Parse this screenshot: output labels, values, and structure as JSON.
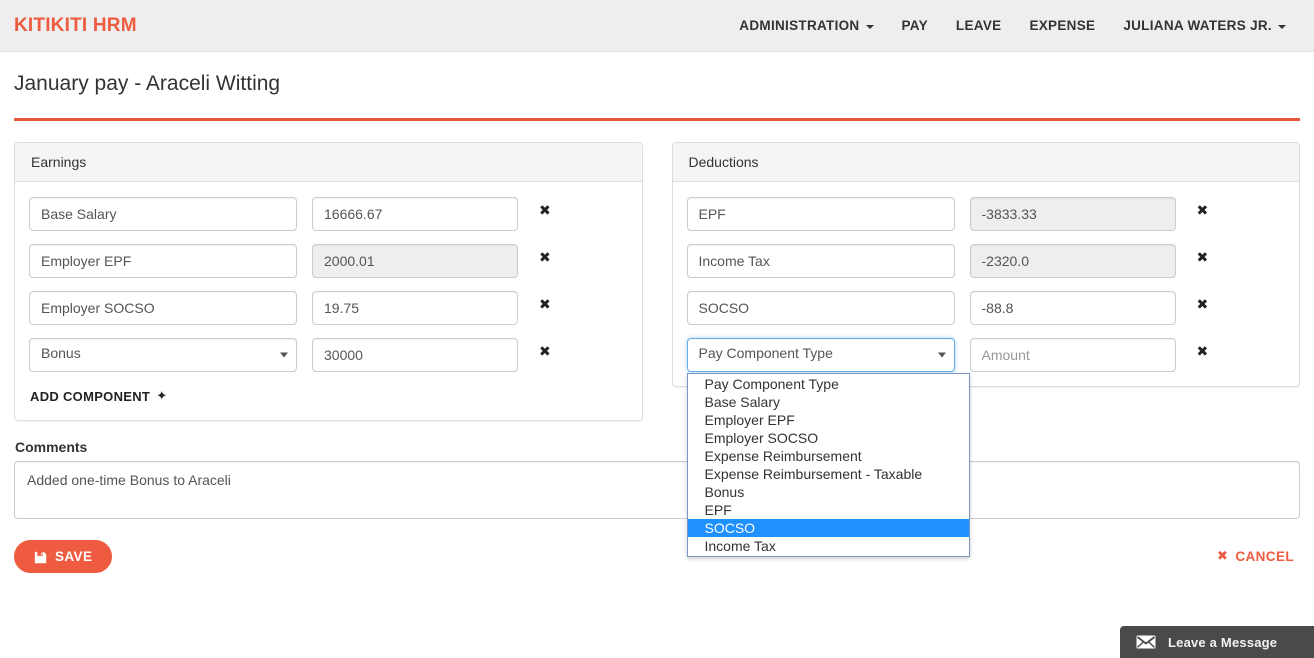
{
  "navbar": {
    "brand": "KITIKITI HRM",
    "items": [
      {
        "label": "ADMINISTRATION",
        "has_caret": true,
        "icon": "chevron-down-icon"
      },
      {
        "label": "PAY",
        "has_caret": false
      },
      {
        "label": "LEAVE",
        "has_caret": false
      },
      {
        "label": "EXPENSE",
        "has_caret": false
      },
      {
        "label": "JULIANA WATERS JR.",
        "has_caret": true,
        "icon": "chevron-down-icon"
      }
    ]
  },
  "page": {
    "title": "January pay - Araceli Witting"
  },
  "earnings": {
    "heading": "Earnings",
    "rows": [
      {
        "name": "Base Salary",
        "amount": "16666.67",
        "name_type": "text",
        "amount_disabled": false,
        "remove_icon": "✖"
      },
      {
        "name": "Employer EPF",
        "amount": "2000.01",
        "name_type": "text",
        "amount_disabled": true,
        "remove_icon": "✖"
      },
      {
        "name": "Employer SOCSO",
        "amount": "19.75",
        "name_type": "text",
        "amount_disabled": false,
        "remove_icon": "✖"
      },
      {
        "name": "Bonus",
        "amount": "30000",
        "name_type": "select",
        "amount_disabled": false,
        "remove_icon": "✖"
      }
    ],
    "add_component_label": "ADD COMPONENT",
    "add_component_icon": "✦"
  },
  "deductions": {
    "heading": "Deductions",
    "rows": [
      {
        "name": "EPF",
        "amount": "-3833.33",
        "name_type": "text",
        "amount_disabled": true,
        "remove_icon": "✖"
      },
      {
        "name": "Income Tax",
        "amount": "-2320.0",
        "name_type": "text",
        "amount_disabled": true,
        "remove_icon": "✖"
      },
      {
        "name": "SOCSO",
        "amount": "-88.8",
        "name_type": "text",
        "amount_disabled": false,
        "remove_icon": "✖"
      }
    ],
    "new_row": {
      "select_value": "Pay Component Type",
      "amount_placeholder": "Amount",
      "amount_value": "",
      "remove_icon": "✖",
      "dropdown_open": true,
      "dropdown_options": [
        "Pay Component Type",
        "Base Salary",
        "Employer EPF",
        "Employer SOCSO",
        "Expense Reimbursement",
        "Expense Reimbursement - Taxable",
        "Bonus",
        "EPF",
        "SOCSO",
        "Income Tax"
      ],
      "dropdown_highlighted": "SOCSO"
    }
  },
  "comments": {
    "label": "Comments",
    "value": "Added one-time Bonus to Araceli",
    "placeholder": ""
  },
  "actions": {
    "save_label": "SAVE",
    "save_icon": "floppy-disk-icon",
    "cancel_label": "CANCEL",
    "cancel_icon": "✖"
  },
  "chat": {
    "label": "Leave a Message",
    "icon": "envelope-icon"
  },
  "colors": {
    "brand": "#ef5b40",
    "rule": "#e8583c",
    "navbar_bg": "#eeeeee",
    "panel_header_bg": "#f5f5f5",
    "highlight": "#1e90ff",
    "chat_bg": "#4a4a4a"
  }
}
